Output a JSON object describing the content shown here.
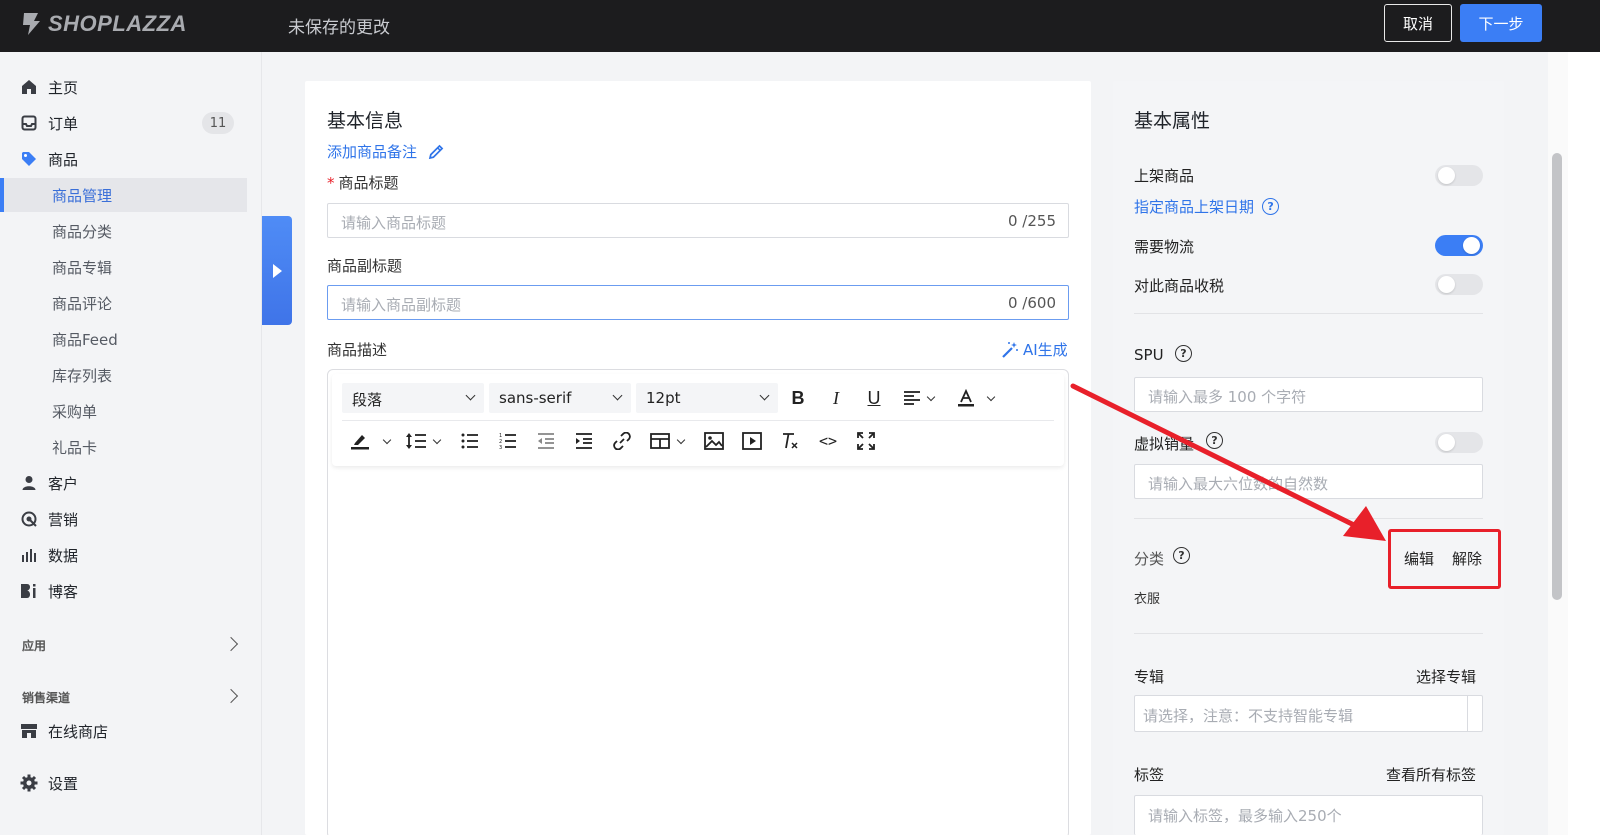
{
  "topbar": {
    "brand": "SHOPLAZZA",
    "status": "未保存的更改",
    "cancel_label": "取消",
    "next_label": "下一步"
  },
  "sidebar": {
    "items": [
      {
        "label": "主页",
        "icon": "home-icon"
      },
      {
        "label": "订单",
        "icon": "inbox-icon",
        "badge": "11"
      },
      {
        "label": "商品",
        "icon": "tag-icon"
      },
      {
        "label": "商品管理"
      },
      {
        "label": "商品分类"
      },
      {
        "label": "商品专辑"
      },
      {
        "label": "商品评论"
      },
      {
        "label": "商品Feed"
      },
      {
        "label": "库存列表"
      },
      {
        "label": "采购单"
      },
      {
        "label": "礼品卡"
      },
      {
        "label": "客户",
        "icon": "user-icon"
      },
      {
        "label": "营销",
        "icon": "marketing-icon"
      },
      {
        "label": "数据",
        "icon": "bar-chart-icon"
      },
      {
        "label": "博客",
        "icon": "blog-icon"
      }
    ],
    "apps_label": "应用",
    "channels_label": "销售渠道",
    "online_store": "在线商店",
    "settings": "设置"
  },
  "basic": {
    "title": "基本信息",
    "add_note": "添加商品备注",
    "title_label": "商品标题",
    "required_mark": "*",
    "title_placeholder": "请输入商品标题",
    "title_count": "0 /255",
    "subtitle_label": "商品副标题",
    "subtitle_placeholder": "请输入商品副标题",
    "subtitle_count": "0 /600",
    "desc_label": "商品描述",
    "ai_label": "AI生成",
    "toolbar": {
      "paragraph": "段落",
      "font": "sans-serif",
      "size": "12pt"
    }
  },
  "attrs": {
    "title": "基本属性",
    "on_shelf": "上架商品",
    "schedule": "指定商品上架日期",
    "shipping": "需要物流",
    "tax": "对此商品收税",
    "spu": "SPU",
    "spu_placeholder": "请输入最多 100 个字符",
    "virtual_sales": "虚拟销量",
    "virtual_placeholder": "请输入最大六位数的自然数",
    "category": "分类",
    "edit": "编辑",
    "remove": "解除",
    "category_value": "衣服",
    "collection": "专辑",
    "choose_collection": "选择专辑",
    "collection_placeholder": "请选择，注意：不支持智能专辑",
    "tags": "标签",
    "view_tags": "查看所有标签",
    "tags_placeholder": "请输入标签，最多输入250个"
  },
  "toggles": {
    "on_shelf": false,
    "shipping": true,
    "tax": false,
    "virtual_sales": false
  },
  "colors": {
    "accent": "#3b7ef5",
    "annotation": "#e8202a",
    "topbar": "#1c1c1e"
  }
}
